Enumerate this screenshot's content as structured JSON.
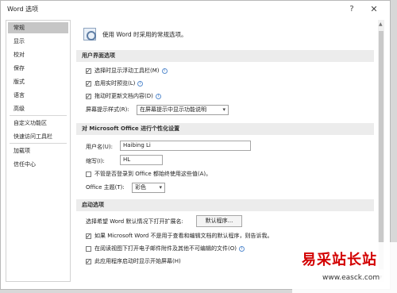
{
  "window": {
    "title": "Word 选项",
    "help_label": "?",
    "close_label": "✕"
  },
  "sidebar": {
    "items": [
      {
        "label": "常规"
      },
      {
        "label": "显示"
      },
      {
        "label": "校对"
      },
      {
        "label": "保存"
      },
      {
        "label": "版式"
      },
      {
        "label": "语言"
      },
      {
        "label": "高级"
      },
      {
        "label": "自定义功能区"
      },
      {
        "label": "快速访问工具栏"
      },
      {
        "label": "加载项"
      },
      {
        "label": "信任中心"
      }
    ]
  },
  "content": {
    "header": "使用 Word 时采用的常规选项。",
    "ui_section": {
      "title": "用户界面选项",
      "options": [
        {
          "label": "选择时显示浮动工具栏(M)",
          "checked": true
        },
        {
          "label": "启用实时预览(L)",
          "checked": true
        },
        {
          "label": "拖动时更新文档内容(D)",
          "checked": true
        }
      ],
      "tooltip_label": "屏幕提示样式(R):",
      "tooltip_value": "在屏幕提示中显示功能说明"
    },
    "personalize_section": {
      "title": "对 Microsoft Office 进行个性化设置",
      "username_label": "用户名(U):",
      "username_value": "Haibing Li",
      "initials_label": "缩写(I):",
      "initials_value": "HL",
      "signin_label": "不管是否登录到 Office 都始终使用这些值(A)。",
      "theme_label": "Office 主题(T):",
      "theme_value": "彩色"
    },
    "startup_section": {
      "title": "启动选项",
      "extension_label": "选择希望 Word 默认情况下打开扩展名:",
      "default_programs_button": "默认程序...",
      "options": [
        {
          "label": "如果 Microsoft Word 不是用于查看和编辑文档的默认程序，则告诉我。",
          "checked": true
        },
        {
          "label": "在阅读视图下打开电子邮件附件及其他不可编辑的文件(O)",
          "checked": false
        },
        {
          "label": "此应用程序启动时显示开始屏幕(H)",
          "checked": true
        }
      ]
    }
  },
  "watermark": {
    "brand": "易采站长站",
    "url": "www.easck.com"
  }
}
